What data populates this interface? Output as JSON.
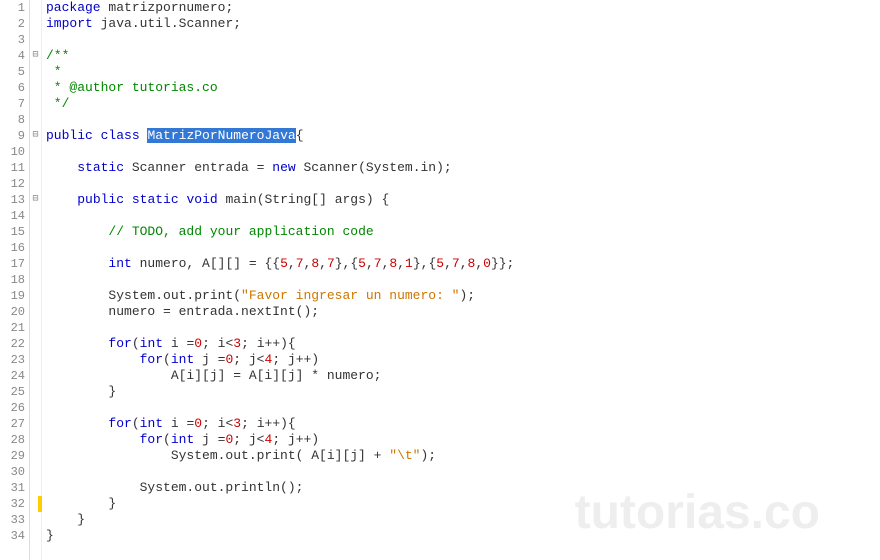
{
  "watermark": "tutorias.co",
  "lines": [
    {
      "num": "1",
      "fold": "",
      "segments": [
        {
          "cls": "kw",
          "t": "package"
        },
        {
          "cls": "plain",
          "t": " "
        },
        {
          "cls": "ident",
          "t": "matrizpornumero"
        },
        {
          "cls": "plain",
          "t": ";"
        }
      ]
    },
    {
      "num": "2",
      "fold": "",
      "segments": [
        {
          "cls": "kw",
          "t": "import"
        },
        {
          "cls": "plain",
          "t": " "
        },
        {
          "cls": "ident",
          "t": "java.util.Scanner;"
        }
      ]
    },
    {
      "num": "3",
      "fold": "",
      "segments": []
    },
    {
      "num": "4",
      "fold": "⊟",
      "segments": [
        {
          "cls": "doc",
          "t": "/**"
        }
      ]
    },
    {
      "num": "5",
      "fold": "",
      "segments": [
        {
          "cls": "doc",
          "t": " *"
        }
      ]
    },
    {
      "num": "6",
      "fold": "",
      "segments": [
        {
          "cls": "doc",
          "t": " * @author tutorias.co"
        }
      ]
    },
    {
      "num": "7",
      "fold": "",
      "segments": [
        {
          "cls": "doc",
          "t": " */"
        }
      ]
    },
    {
      "num": "8",
      "fold": "",
      "segments": []
    },
    {
      "num": "9",
      "fold": "⊟",
      "segments": [
        {
          "cls": "kw",
          "t": "public"
        },
        {
          "cls": "plain",
          "t": " "
        },
        {
          "cls": "kw",
          "t": "class"
        },
        {
          "cls": "plain",
          "t": " "
        },
        {
          "cls": "sel",
          "t": "MatrizPorNumeroJava"
        },
        {
          "cls": "plain",
          "t": "{"
        }
      ]
    },
    {
      "num": "10",
      "fold": "",
      "segments": []
    },
    {
      "num": "11",
      "fold": "",
      "segments": [
        {
          "cls": "plain",
          "t": "    "
        },
        {
          "cls": "kw",
          "t": "static"
        },
        {
          "cls": "plain",
          "t": " Scanner entrada = "
        },
        {
          "cls": "kw",
          "t": "new"
        },
        {
          "cls": "plain",
          "t": " Scanner(System.in);"
        }
      ]
    },
    {
      "num": "12",
      "fold": "",
      "segments": []
    },
    {
      "num": "13",
      "fold": "⊟",
      "segments": [
        {
          "cls": "plain",
          "t": "    "
        },
        {
          "cls": "kw",
          "t": "public"
        },
        {
          "cls": "plain",
          "t": " "
        },
        {
          "cls": "kw",
          "t": "static"
        },
        {
          "cls": "plain",
          "t": " "
        },
        {
          "cls": "kw",
          "t": "void"
        },
        {
          "cls": "plain",
          "t": " main(String[] args) {"
        }
      ]
    },
    {
      "num": "14",
      "fold": "",
      "segments": []
    },
    {
      "num": "15",
      "fold": "",
      "segments": [
        {
          "cls": "plain",
          "t": "        "
        },
        {
          "cls": "doc",
          "t": "// TODO, add your application code"
        }
      ]
    },
    {
      "num": "16",
      "fold": "",
      "segments": []
    },
    {
      "num": "17",
      "fold": "",
      "segments": [
        {
          "cls": "plain",
          "t": "        "
        },
        {
          "cls": "kw",
          "t": "int"
        },
        {
          "cls": "plain",
          "t": " numero, A[][] = {{"
        },
        {
          "cls": "num",
          "t": "5"
        },
        {
          "cls": "plain",
          "t": ","
        },
        {
          "cls": "num",
          "t": "7"
        },
        {
          "cls": "plain",
          "t": ","
        },
        {
          "cls": "num",
          "t": "8"
        },
        {
          "cls": "plain",
          "t": ","
        },
        {
          "cls": "num",
          "t": "7"
        },
        {
          "cls": "plain",
          "t": "},{"
        },
        {
          "cls": "num",
          "t": "5"
        },
        {
          "cls": "plain",
          "t": ","
        },
        {
          "cls": "num",
          "t": "7"
        },
        {
          "cls": "plain",
          "t": ","
        },
        {
          "cls": "num",
          "t": "8"
        },
        {
          "cls": "plain",
          "t": ","
        },
        {
          "cls": "num",
          "t": "1"
        },
        {
          "cls": "plain",
          "t": "},{"
        },
        {
          "cls": "num",
          "t": "5"
        },
        {
          "cls": "plain",
          "t": ","
        },
        {
          "cls": "num",
          "t": "7"
        },
        {
          "cls": "plain",
          "t": ","
        },
        {
          "cls": "num",
          "t": "8"
        },
        {
          "cls": "plain",
          "t": ","
        },
        {
          "cls": "num",
          "t": "0"
        },
        {
          "cls": "plain",
          "t": "}};"
        }
      ]
    },
    {
      "num": "18",
      "fold": "",
      "segments": []
    },
    {
      "num": "19",
      "fold": "",
      "segments": [
        {
          "cls": "plain",
          "t": "        System.out.print("
        },
        {
          "cls": "str",
          "t": "\"Favor ingresar un numero: \""
        },
        {
          "cls": "plain",
          "t": ");"
        }
      ]
    },
    {
      "num": "20",
      "fold": "",
      "segments": [
        {
          "cls": "plain",
          "t": "        numero = entrada.nextInt();"
        }
      ]
    },
    {
      "num": "21",
      "fold": "",
      "segments": []
    },
    {
      "num": "22",
      "fold": "",
      "segments": [
        {
          "cls": "plain",
          "t": "        "
        },
        {
          "cls": "kw",
          "t": "for"
        },
        {
          "cls": "plain",
          "t": "("
        },
        {
          "cls": "kw",
          "t": "int"
        },
        {
          "cls": "plain",
          "t": " i ="
        },
        {
          "cls": "num",
          "t": "0"
        },
        {
          "cls": "plain",
          "t": "; i<"
        },
        {
          "cls": "num",
          "t": "3"
        },
        {
          "cls": "plain",
          "t": "; i++){"
        }
      ]
    },
    {
      "num": "23",
      "fold": "",
      "segments": [
        {
          "cls": "plain",
          "t": "            "
        },
        {
          "cls": "kw",
          "t": "for"
        },
        {
          "cls": "plain",
          "t": "("
        },
        {
          "cls": "kw",
          "t": "int"
        },
        {
          "cls": "plain",
          "t": " j ="
        },
        {
          "cls": "num",
          "t": "0"
        },
        {
          "cls": "plain",
          "t": "; j<"
        },
        {
          "cls": "num",
          "t": "4"
        },
        {
          "cls": "plain",
          "t": "; j++)"
        }
      ]
    },
    {
      "num": "24",
      "fold": "",
      "segments": [
        {
          "cls": "plain",
          "t": "                A[i][j] = A[i][j] * numero;"
        }
      ]
    },
    {
      "num": "25",
      "fold": "",
      "segments": [
        {
          "cls": "plain",
          "t": "        }"
        }
      ]
    },
    {
      "num": "26",
      "fold": "",
      "segments": []
    },
    {
      "num": "27",
      "fold": "",
      "segments": [
        {
          "cls": "plain",
          "t": "        "
        },
        {
          "cls": "kw",
          "t": "for"
        },
        {
          "cls": "plain",
          "t": "("
        },
        {
          "cls": "kw",
          "t": "int"
        },
        {
          "cls": "plain",
          "t": " i ="
        },
        {
          "cls": "num",
          "t": "0"
        },
        {
          "cls": "plain",
          "t": "; i<"
        },
        {
          "cls": "num",
          "t": "3"
        },
        {
          "cls": "plain",
          "t": "; i++){"
        }
      ]
    },
    {
      "num": "28",
      "fold": "",
      "segments": [
        {
          "cls": "plain",
          "t": "            "
        },
        {
          "cls": "kw",
          "t": "for"
        },
        {
          "cls": "plain",
          "t": "("
        },
        {
          "cls": "kw",
          "t": "int"
        },
        {
          "cls": "plain",
          "t": " j ="
        },
        {
          "cls": "num",
          "t": "0"
        },
        {
          "cls": "plain",
          "t": "; j<"
        },
        {
          "cls": "num",
          "t": "4"
        },
        {
          "cls": "plain",
          "t": "; j++)"
        }
      ]
    },
    {
      "num": "29",
      "fold": "",
      "segments": [
        {
          "cls": "plain",
          "t": "                System.out.print( A[i][j] + "
        },
        {
          "cls": "str",
          "t": "\"\\t\""
        },
        {
          "cls": "plain",
          "t": ");"
        }
      ]
    },
    {
      "num": "30",
      "fold": "",
      "segments": []
    },
    {
      "num": "31",
      "fold": "",
      "segments": [
        {
          "cls": "plain",
          "t": "            System.out.println();"
        }
      ]
    },
    {
      "num": "32",
      "fold": "",
      "segments": [
        {
          "cls": "plain",
          "t": "        }"
        }
      ],
      "mark": true
    },
    {
      "num": "33",
      "fold": "",
      "segments": [
        {
          "cls": "plain",
          "t": "    }"
        }
      ]
    },
    {
      "num": "34",
      "fold": "",
      "segments": [
        {
          "cls": "plain",
          "t": "}"
        }
      ]
    }
  ]
}
